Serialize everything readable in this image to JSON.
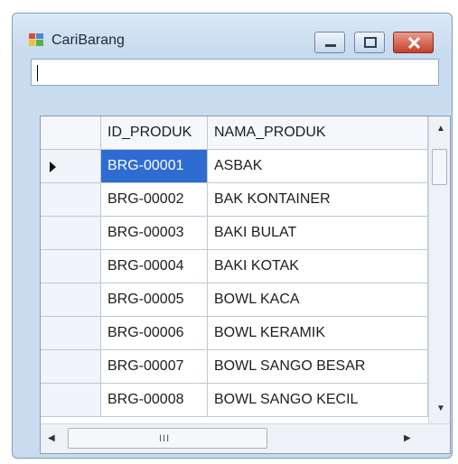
{
  "window": {
    "title": "CariBarang"
  },
  "search": {
    "value": ""
  },
  "grid": {
    "columns": [
      "ID_PRODUK",
      "NAMA_PRODUK"
    ],
    "rows": [
      {
        "id": "BRG-00001",
        "name": "ASBAK"
      },
      {
        "id": "BRG-00002",
        "name": "BAK KONTAINER"
      },
      {
        "id": "BRG-00003",
        "name": "BAKI BULAT"
      },
      {
        "id": "BRG-00004",
        "name": "BAKI KOTAK"
      },
      {
        "id": "BRG-00005",
        "name": "BOWL KACA"
      },
      {
        "id": "BRG-00006",
        "name": "BOWL KERAMIK"
      },
      {
        "id": "BRG-00007",
        "name": "BOWL SANGO BESAR"
      },
      {
        "id": "BRG-00008",
        "name": "BOWL SANGO KECIL"
      }
    ],
    "selected_row": 0
  },
  "scrollbars": {
    "h_grip": "III"
  },
  "icons": {
    "app": "form-icon",
    "minimize": "minimize-icon",
    "maximize": "maximize-icon",
    "close": "close-icon",
    "current_row": "row-pointer-icon"
  },
  "colors": {
    "selection": "#2f6cd2",
    "window_frame": "#c9dcef",
    "close_button": "#c3412c"
  }
}
